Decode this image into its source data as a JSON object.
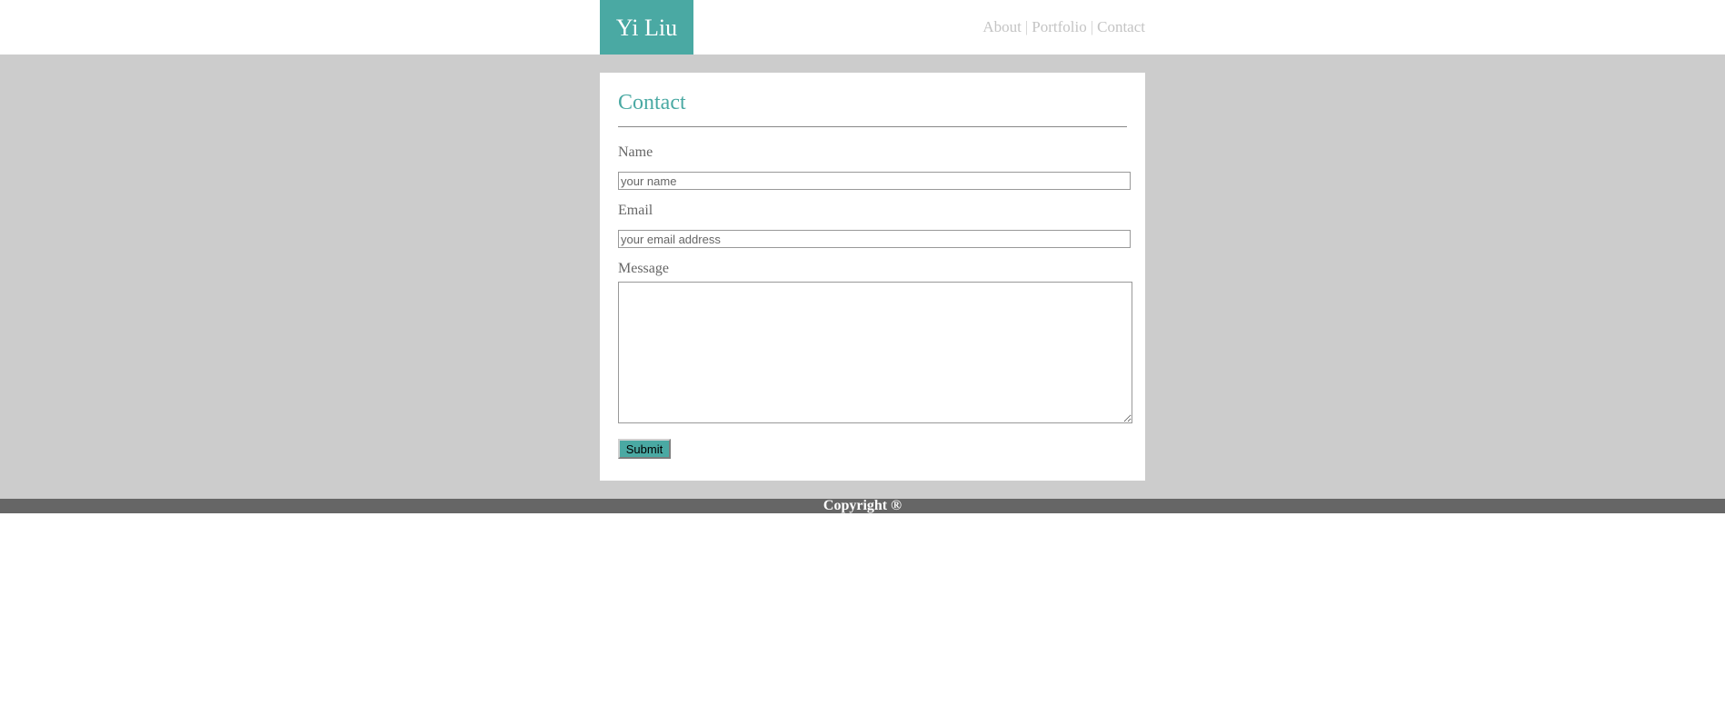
{
  "header": {
    "logo_text": "Yi Liu",
    "nav": [
      {
        "label": "About"
      },
      {
        "label": "Portfolio"
      },
      {
        "label": "Contact"
      }
    ],
    "separator": "|"
  },
  "contact": {
    "title": "Contact",
    "name_label": "Name",
    "name_placeholder": "your name",
    "email_label": "Email",
    "email_placeholder": "your email address",
    "message_label": "Message",
    "submit_label": "Submit"
  },
  "footer": {
    "copyright": "Copyright ®"
  },
  "colors": {
    "accent": "#4aa9a3",
    "main_bg": "#cccccc",
    "footer_bg": "#666666",
    "nav_text": "#c4c4c4"
  }
}
